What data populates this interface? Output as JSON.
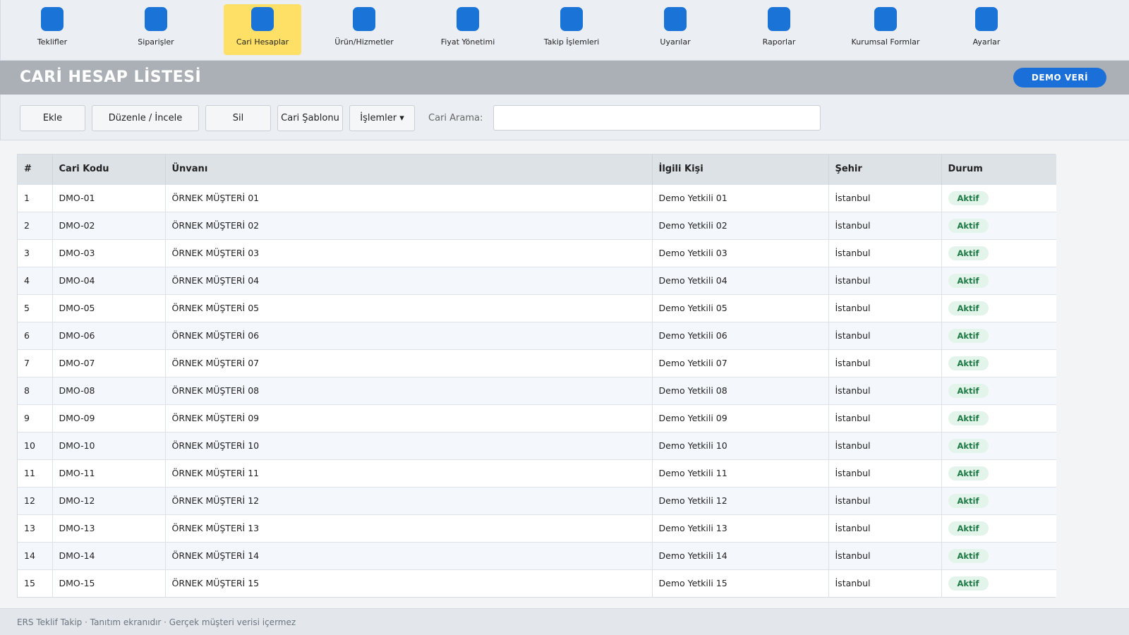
{
  "nav": {
    "items": [
      {
        "label": "Teklifler",
        "icon": "quotes-icon"
      },
      {
        "label": "Siparişler",
        "icon": "orders-icon"
      },
      {
        "label": "Cari Hesaplar",
        "icon": "accounts-icon",
        "active": true
      },
      {
        "label": "Ürün/Hizmetler",
        "icon": "products-icon"
      },
      {
        "label": "Fiyat Yönetimi",
        "icon": "pricing-icon"
      },
      {
        "label": "Takip İşlemleri",
        "icon": "tracking-icon"
      },
      {
        "label": "Uyarılar",
        "icon": "alerts-icon"
      },
      {
        "label": "Raporlar",
        "icon": "reports-icon"
      },
      {
        "label": "Kurumsal Formlar",
        "icon": "forms-icon"
      },
      {
        "label": "Ayarlar",
        "icon": "settings-icon"
      }
    ],
    "active_color": "#ffe066",
    "icon_color": "#1a73d6"
  },
  "header": {
    "title": "CARİ HESAP LİSTESİ",
    "badge": "DEMO VERİ"
  },
  "toolbar": {
    "add_label": "Ekle",
    "edit_label": "Düzenle / İncele",
    "delete_label": "Sil",
    "template_label": "Cari Şablonu",
    "actions_label": "İşlemler ▾",
    "search_label": "Cari Arama:",
    "search_value": "",
    "search_placeholder": ""
  },
  "table": {
    "columns": [
      "#",
      "Cari Kodu",
      "Ünvanı",
      "İlgili Kişi",
      "Şehir",
      "Durum"
    ],
    "rows": [
      {
        "no": "1",
        "code": "DMO-01",
        "title": "ÖRNEK MÜŞTERİ 01",
        "contact": "Demo Yetkili 01",
        "city": "İstanbul",
        "status": "Aktif"
      },
      {
        "no": "2",
        "code": "DMO-02",
        "title": "ÖRNEK MÜŞTERİ 02",
        "contact": "Demo Yetkili 02",
        "city": "İstanbul",
        "status": "Aktif"
      },
      {
        "no": "3",
        "code": "DMO-03",
        "title": "ÖRNEK MÜŞTERİ 03",
        "contact": "Demo Yetkili 03",
        "city": "İstanbul",
        "status": "Aktif"
      },
      {
        "no": "4",
        "code": "DMO-04",
        "title": "ÖRNEK MÜŞTERİ 04",
        "contact": "Demo Yetkili 04",
        "city": "İstanbul",
        "status": "Aktif"
      },
      {
        "no": "5",
        "code": "DMO-05",
        "title": "ÖRNEK MÜŞTERİ 05",
        "contact": "Demo Yetkili 05",
        "city": "İstanbul",
        "status": "Aktif"
      },
      {
        "no": "6",
        "code": "DMO-06",
        "title": "ÖRNEK MÜŞTERİ 06",
        "contact": "Demo Yetkili 06",
        "city": "İstanbul",
        "status": "Aktif"
      },
      {
        "no": "7",
        "code": "DMO-07",
        "title": "ÖRNEK MÜŞTERİ 07",
        "contact": "Demo Yetkili 07",
        "city": "İstanbul",
        "status": "Aktif"
      },
      {
        "no": "8",
        "code": "DMO-08",
        "title": "ÖRNEK MÜŞTERİ 08",
        "contact": "Demo Yetkili 08",
        "city": "İstanbul",
        "status": "Aktif"
      },
      {
        "no": "9",
        "code": "DMO-09",
        "title": "ÖRNEK MÜŞTERİ 09",
        "contact": "Demo Yetkili 09",
        "city": "İstanbul",
        "status": "Aktif"
      },
      {
        "no": "10",
        "code": "DMO-10",
        "title": "ÖRNEK MÜŞTERİ 10",
        "contact": "Demo Yetkili 10",
        "city": "İstanbul",
        "status": "Aktif"
      },
      {
        "no": "11",
        "code": "DMO-11",
        "title": "ÖRNEK MÜŞTERİ 11",
        "contact": "Demo Yetkili 11",
        "city": "İstanbul",
        "status": "Aktif"
      },
      {
        "no": "12",
        "code": "DMO-12",
        "title": "ÖRNEK MÜŞTERİ 12",
        "contact": "Demo Yetkili 12",
        "city": "İstanbul",
        "status": "Aktif"
      },
      {
        "no": "13",
        "code": "DMO-13",
        "title": "ÖRNEK MÜŞTERİ 13",
        "contact": "Demo Yetkili 13",
        "city": "İstanbul",
        "status": "Aktif"
      },
      {
        "no": "14",
        "code": "DMO-14",
        "title": "ÖRNEK MÜŞTERİ 14",
        "contact": "Demo Yetkili 14",
        "city": "İstanbul",
        "status": "Aktif"
      },
      {
        "no": "15",
        "code": "DMO-15",
        "title": "ÖRNEK MÜŞTERİ 15",
        "contact": "Demo Yetkili 15",
        "city": "İstanbul",
        "status": "Aktif"
      }
    ]
  },
  "footer": {
    "text": "ERS Teklif Takip · Tanıtım ekranıdır · Gerçek müşteri verisi içermez"
  }
}
